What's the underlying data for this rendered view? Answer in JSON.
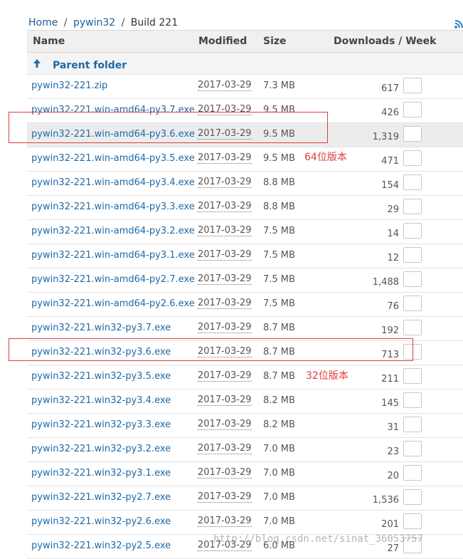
{
  "breadcrumb": [
    {
      "label": "Home"
    },
    {
      "label": "pywin32"
    },
    {
      "label": "Build 221"
    }
  ],
  "breadcrumb_sep": "/",
  "columns": {
    "name": "Name",
    "modified": "Modified",
    "size": "Size",
    "downloads": "Downloads / Week"
  },
  "parent_folder": "Parent folder",
  "files": [
    {
      "name": "pywin32-221.zip",
      "modified": "2017-03-29",
      "size": "7.3 MB",
      "downloads": "617"
    },
    {
      "name": "pywin32-221.win-amd64-py3.7.exe",
      "modified": "2017-03-29",
      "size": "9.5 MB",
      "downloads": "426"
    },
    {
      "name": "pywin32-221.win-amd64-py3.6.exe",
      "modified": "2017-03-29",
      "size": "9.5 MB",
      "downloads": "1,319"
    },
    {
      "name": "pywin32-221.win-amd64-py3.5.exe",
      "modified": "2017-03-29",
      "size": "9.5 MB",
      "downloads": "471"
    },
    {
      "name": "pywin32-221.win-amd64-py3.4.exe",
      "modified": "2017-03-29",
      "size": "8.8 MB",
      "downloads": "154"
    },
    {
      "name": "pywin32-221.win-amd64-py3.3.exe",
      "modified": "2017-03-29",
      "size": "8.8 MB",
      "downloads": "29"
    },
    {
      "name": "pywin32-221.win-amd64-py3.2.exe",
      "modified": "2017-03-29",
      "size": "7.5 MB",
      "downloads": "14"
    },
    {
      "name": "pywin32-221.win-amd64-py3.1.exe",
      "modified": "2017-03-29",
      "size": "7.5 MB",
      "downloads": "12"
    },
    {
      "name": "pywin32-221.win-amd64-py2.7.exe",
      "modified": "2017-03-29",
      "size": "7.5 MB",
      "downloads": "1,488"
    },
    {
      "name": "pywin32-221.win-amd64-py2.6.exe",
      "modified": "2017-03-29",
      "size": "7.5 MB",
      "downloads": "76"
    },
    {
      "name": "pywin32-221.win32-py3.7.exe",
      "modified": "2017-03-29",
      "size": "8.7 MB",
      "downloads": "192"
    },
    {
      "name": "pywin32-221.win32-py3.6.exe",
      "modified": "2017-03-29",
      "size": "8.7 MB",
      "downloads": "713"
    },
    {
      "name": "pywin32-221.win32-py3.5.exe",
      "modified": "2017-03-29",
      "size": "8.7 MB",
      "downloads": "211"
    },
    {
      "name": "pywin32-221.win32-py3.4.exe",
      "modified": "2017-03-29",
      "size": "8.2 MB",
      "downloads": "145"
    },
    {
      "name": "pywin32-221.win32-py3.3.exe",
      "modified": "2017-03-29",
      "size": "8.2 MB",
      "downloads": "31"
    },
    {
      "name": "pywin32-221.win32-py3.2.exe",
      "modified": "2017-03-29",
      "size": "7.0 MB",
      "downloads": "23"
    },
    {
      "name": "pywin32-221.win32-py3.1.exe",
      "modified": "2017-03-29",
      "size": "7.0 MB",
      "downloads": "20"
    },
    {
      "name": "pywin32-221.win32-py2.7.exe",
      "modified": "2017-03-29",
      "size": "7.0 MB",
      "downloads": "1,536"
    },
    {
      "name": "pywin32-221.win32-py2.6.exe",
      "modified": "2017-03-29",
      "size": "7.0 MB",
      "downloads": "201"
    },
    {
      "name": "pywin32-221.win32-py2.5.exe",
      "modified": "2017-03-29",
      "size": "6.0 MB",
      "downloads": "27"
    }
  ],
  "annotations": {
    "label_64": "64位版本",
    "label_32": "32位版本"
  },
  "watermark": "http://blog.csdn.net/sinat_36053757",
  "colors": {
    "link": "#1e6aa8",
    "annotation": "#e03c3c",
    "header_bg": "#f0f0f0"
  }
}
